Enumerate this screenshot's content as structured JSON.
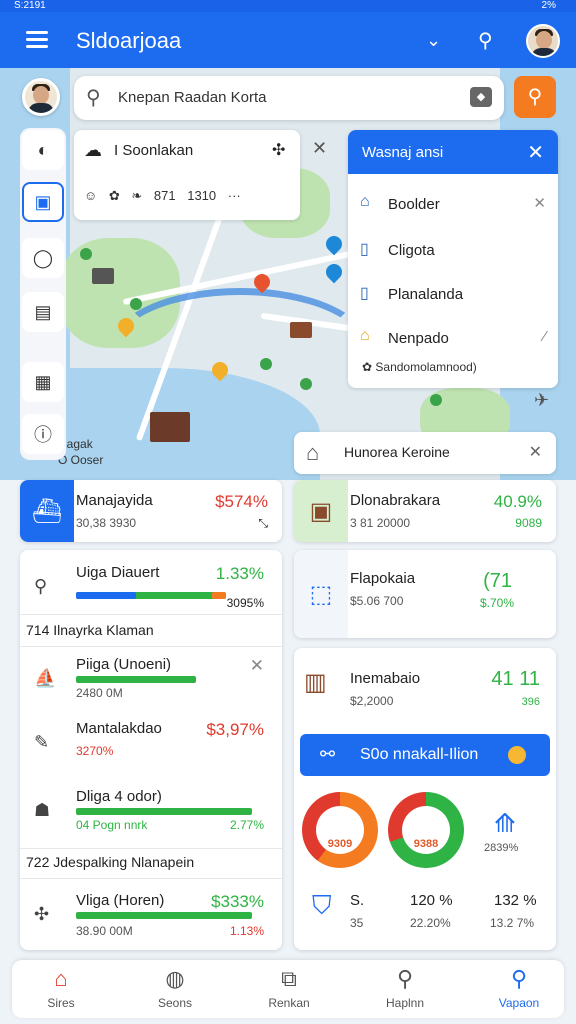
{
  "status": {
    "left": "S:2191",
    "right": "2%"
  },
  "app": {
    "title": "Sldoarjoaa"
  },
  "search": {
    "placeholder": "Knepan Raadan Korta"
  },
  "popup": {
    "title": "I Soonlakan",
    "meta": "871 1310 ···"
  },
  "manager": {
    "title": "Wasnaj ansi",
    "items": [
      {
        "label": "Boolder"
      },
      {
        "label": "Cligota"
      },
      {
        "label": "Planalanda"
      },
      {
        "label": "Nenpado"
      }
    ],
    "footer": "Sandomolamnood)"
  },
  "map": {
    "label_1": "Jlagak",
    "label_2": "O Ooser"
  },
  "right_header": {
    "title": "Hunorea Keroine"
  },
  "stat_left_1": {
    "title": "Manajayida",
    "sub": "30,38 3930",
    "value": "$574%"
  },
  "stat_right_1": {
    "title": "Dlonabrakara",
    "sub": "3 81 20000",
    "value": "40.9%",
    "value2": "9089"
  },
  "list_top": {
    "title": "Uiga Diauert",
    "value": "1.33%",
    "value2": "3095%"
  },
  "list_section_1": "714 Ilnayrka Klaman",
  "list_rows": [
    {
      "title": "Piiga (Unoeni)",
      "sub": "2480 0M",
      "value": "",
      "value2": ""
    },
    {
      "title": "Mantalakdao",
      "sub": "3270%",
      "value": "$3,97%",
      "value2": ""
    },
    {
      "title": "Dliga 4 odor)",
      "sub": "04 Pogn nnrk",
      "value": "",
      "value2": "2.77%"
    }
  ],
  "list_section_2": "722 Jdespalking Nlanapein",
  "list_last": {
    "title": "Vliga (Horen)",
    "sub": "38.90 00M",
    "value": "$333%",
    "value2": "1.13%"
  },
  "stat_right_2": {
    "title": "Flapokaia",
    "sub": "$5.06 700",
    "value": "(71",
    "value2": "$.70%"
  },
  "stat_right_3": {
    "title": "Inemabaio",
    "sub": "$2,2000",
    "value": "41 11",
    "value2": "396"
  },
  "action": {
    "label": "S0o nnakall-Ilion"
  },
  "donuts": [
    {
      "label": "9309"
    },
    {
      "label": "9388"
    },
    {
      "label": "2839%"
    }
  ],
  "summary": {
    "a": "S.",
    "a2": "35",
    "b": "120 %",
    "b2": "22.20%",
    "c": "132 %",
    "c2": "13.2 7%"
  },
  "bottom_nav": [
    {
      "label": "Sires"
    },
    {
      "label": "Seons"
    },
    {
      "label": "Renkan"
    },
    {
      "label": "Haplnn"
    },
    {
      "label": "Vapaon"
    }
  ],
  "colors": {
    "primary": "#1d6cf0",
    "green": "#2fb344",
    "red": "#e03a2f",
    "orange": "#f47b20"
  }
}
